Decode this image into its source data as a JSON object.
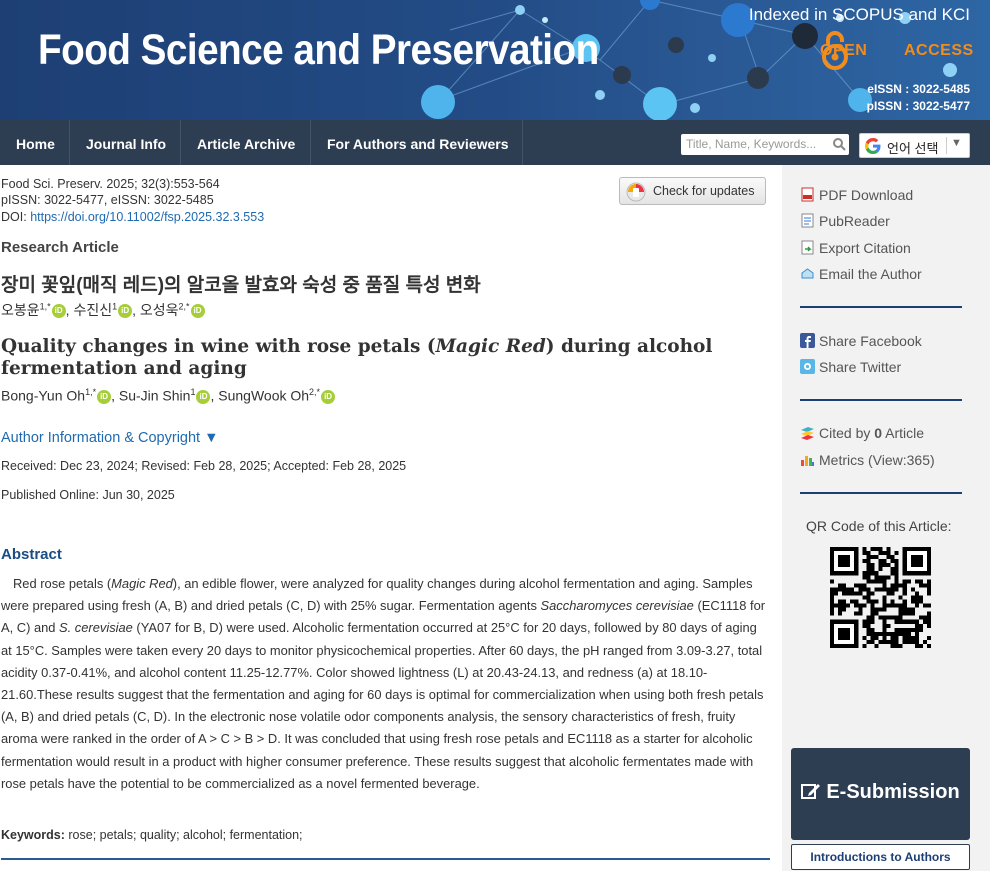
{
  "banner": {
    "journal_title": "Food Science and Preservation",
    "indexed": "Indexed in SCOPUS and KCI",
    "open_access_left": "OPEN",
    "open_access_right": "ACCESS",
    "eissn": "eISSN : 3022-5485",
    "pissn": "pISSN : 3022-5477"
  },
  "nav": {
    "items": [
      "Home",
      "Journal Info",
      "Article Archive",
      "For Authors and Reviewers"
    ],
    "search_placeholder": "Title, Name, Keywords...",
    "language_label": "언어 선택"
  },
  "citation": {
    "line1": "Food Sci. Preserv. 2025; 32(3):553-564",
    "line2": "pISSN: 3022-5477, eISSN: 3022-5485",
    "doi_label": "DOI:",
    "doi_link": "https://doi.org/10.11002/fsp.2025.32.3.553",
    "check_updates": "Check for updates"
  },
  "article": {
    "type": "Research Article",
    "title_ko": "장미 꽃잎(매직 레드)의 알코올 발효와 숙성 중 품질 특성 변화",
    "authors_ko": [
      {
        "name": "오봉윤",
        "sup": "1,*",
        "sep": ", "
      },
      {
        "name": "수진신",
        "sup": "1",
        "sep": ", "
      },
      {
        "name": "오성욱",
        "sup": "2,*",
        "sep": ""
      }
    ],
    "title_en_pre": "Quality changes in wine with rose petals (",
    "title_en_em": "Magic Red",
    "title_en_post": ") during alcohol fermentation and aging",
    "authors_en": [
      {
        "name": "Bong-Yun Oh",
        "sup": "1,*",
        "sep": ", "
      },
      {
        "name": "Su-Jin Shin",
        "sup": "1",
        "sep": ", "
      },
      {
        "name": "SungWook Oh",
        "sup": "2,*",
        "sep": ""
      }
    ],
    "orcid_label": "iD",
    "author_info_link": "Author Information & Copyright ▼",
    "dates": "Received: Dec 23, 2024; Revised: Feb 28, 2025; Accepted: Feb 28, 2025",
    "published": "Published Online: Jun 30, 2025"
  },
  "abstract": {
    "heading": "Abstract",
    "p1": "Red rose petals (",
    "e1": "Magic Red",
    "p2": "), an edible flower, were analyzed for quality changes during alcohol fermentation and aging. Samples were prepared using fresh (A, B) and dried petals (C, D) with 25% sugar. Fermentation agents ",
    "e2": "Saccharomyces cerevisiae",
    "p3": " (EC1118 for A, C) and ",
    "e3": "S. cerevisiae",
    "p4": " (YA07 for B, D) were used. Alcoholic fermentation occurred at 25°C for 20 days, followed by 80 days of aging at 15°C. Samples were taken every 20 days to monitor physicochemical properties. After 60 days, the pH ranged from 3.09-3.27, total acidity 0.37-0.41%, and alcohol content 11.25-12.77%. Color showed lightness (L) at 20.43-24.13, and redness (a) at 18.10-21.60.These results suggest that the fermentation and aging for 60 days is optimal for commercialization when using both fresh petals (A, B) and dried petals (C, D). In the electronic nose volatile odor components analysis, the sensory characteristics of fresh, fruity aroma were ranked in the order of A > C > B > D. It was concluded that using fresh rose petals and EC1118 as a starter for alcoholic fermentation would result in a product with higher consumer preference. These results suggest that alcoholic fermentates made with rose petals have the potential to be commercialized as a novel fermented beverage.",
    "keywords_label": "Keywords:",
    "keywords": " rose; petals; quality; alcohol; fermentation;"
  },
  "sidebar": {
    "pdf": "PDF Download",
    "pubreader": "PubReader",
    "export": "Export Citation",
    "email": "Email the Author",
    "facebook": "Share Facebook",
    "twitter": "Share Twitter",
    "cited_pre": "Cited by ",
    "cited_count": "0",
    "cited_post": " Article",
    "metrics": "Metrics (View:365)",
    "qr_label": "QR Code of this Article:",
    "esubmission": "E-Submission",
    "intro_authors": "Introductions to Authors"
  },
  "colors": {
    "banner": "#1d3f74",
    "nav": "#2d3e52",
    "link": "#1f6ab0",
    "open_access": "#f28c1c",
    "orcid": "#a6ce39"
  }
}
